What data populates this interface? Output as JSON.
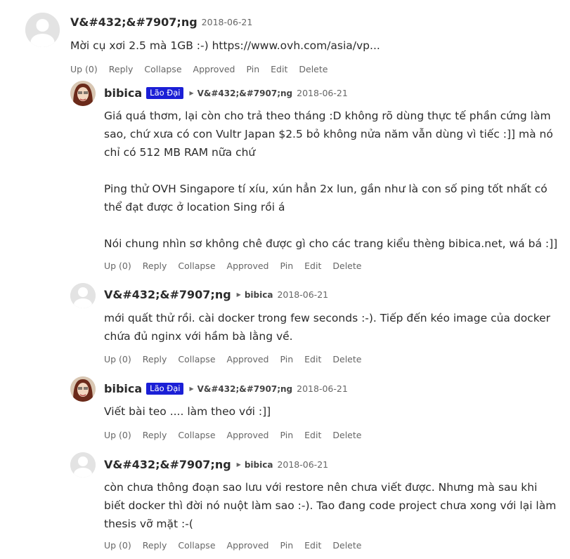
{
  "actions": {
    "up": "Up (0)",
    "reply": "Reply",
    "collapse": "Collapse",
    "approved": "Approved",
    "pin": "Pin",
    "edit": "Edit",
    "delete": "Delete"
  },
  "comments": [
    {
      "author": "V&#432;&#7907;ng",
      "date": "2018-06-21",
      "text": "Mời cụ xơi 2.5 mà 1GB :-) https://www.ovh.com/asia/vp..."
    },
    {
      "author": "bibica",
      "badge": "Lão Đại",
      "reply_to": "V&#432;&#7907;ng",
      "date": "2018-06-21",
      "text": "Giá quá thơm, lại còn cho trả theo tháng :D không rõ dùng thực tế phần cứng làm\nsao, chứ xưa có con Vultr Japan $2.5 bỏ không nửa năm vẫn dùng vì tiếc :]] mà nó\nchỉ có 512 MB RAM nữa chứ\n\nPing thử OVH Singapore tí xíu, xún hẳn 2x lun, gần như là con số ping tốt nhất có\nthể đạt được ở location Sing rồi á\n\nNói chung nhìn sơ không chê được gì cho các trang kiểu thèng bibica.net, wá bá :]]"
    },
    {
      "author": "V&#432;&#7907;ng",
      "reply_to": "bibica",
      "date": "2018-06-21",
      "text": "mới quất thử rồi. cài docker trong few seconds :-). Tiếp đến kéo image của docker\nchứa đủ nginx với hầm bà lằng về."
    },
    {
      "author": "bibica",
      "badge": "Lão Đại",
      "reply_to": "V&#432;&#7907;ng",
      "date": "2018-06-21",
      "text": "Viết bài teo .... làm theo với :]]"
    },
    {
      "author": "V&#432;&#7907;ng",
      "reply_to": "bibica",
      "date": "2018-06-21",
      "text": "còn chưa thông đoạn sao lưu với restore nên chưa viết được. Nhưng mà sau khi\nbiết docker thì đời nó nuột làm sao :-). Tao đang code project chưa xong với lại làm\nthesis vỡ mặt :-("
    }
  ]
}
